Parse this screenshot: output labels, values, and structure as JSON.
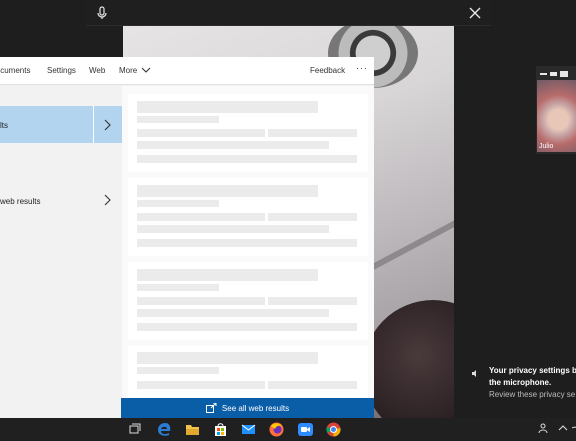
{
  "voice_bar": {
    "mic_icon": "microphone-icon",
    "close_icon": "close-icon"
  },
  "search_panel": {
    "tabs": [
      "Documents",
      "Settings",
      "Web",
      "More"
    ],
    "more_icon": "chevron-down-icon",
    "feedback_label": "Feedback",
    "options_label": "···",
    "results": [
      {
        "label": "Best match results",
        "visible_text": "lts"
      },
      {
        "label": "Search the web results",
        "visible_text": "web results"
      }
    ],
    "see_all_label": "See all web results",
    "see_all_icon": "external-link-icon"
  },
  "video_tile": {
    "name": "Julio"
  },
  "notification": {
    "line1": "Your privacy settings b",
    "line2": "the microphone.",
    "line3": "Review these privacy se"
  },
  "colors": {
    "accent": "#0a5ea8",
    "selected_row": "#b3d4ef",
    "taskbar": "#202020",
    "firefox": "#ff7139",
    "zoom": "#2d8cff",
    "chrome_red": "#db4437",
    "chrome_green": "#0f9d58",
    "chrome_yellow": "#f4b400"
  }
}
